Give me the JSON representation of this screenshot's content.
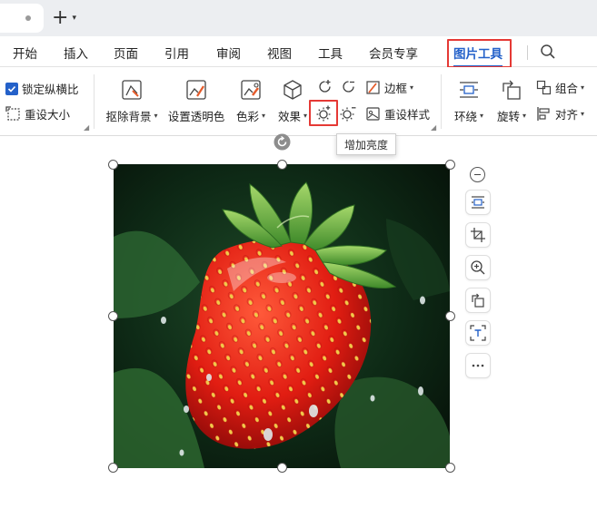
{
  "topbar": {
    "new_tab_label": "+"
  },
  "menu": {
    "items": [
      "开始",
      "插入",
      "页面",
      "引用",
      "审阅",
      "视图",
      "工具",
      "会员专享",
      "图片工具"
    ]
  },
  "ribbon": {
    "lock_ratio": "锁定纵横比",
    "reset_size": "重设大小",
    "remove_bg": "抠除背景",
    "set_transparent": "设置透明色",
    "color": "色彩",
    "effects": "效果",
    "border": "边框",
    "reset_style": "重设样式",
    "wrap": "环绕",
    "rotate": "旋转",
    "group": "组合",
    "align": "对齐"
  },
  "tooltip": {
    "text": "增加亮度"
  },
  "colors": {
    "accent": "#2461c9",
    "highlight": "#e53935"
  },
  "floating_toolbar": [
    "collapse-icon",
    "wrap-text-icon",
    "crop-icon",
    "zoom-in-icon",
    "rotate-icon",
    "text-extract-icon",
    "more-icon"
  ]
}
